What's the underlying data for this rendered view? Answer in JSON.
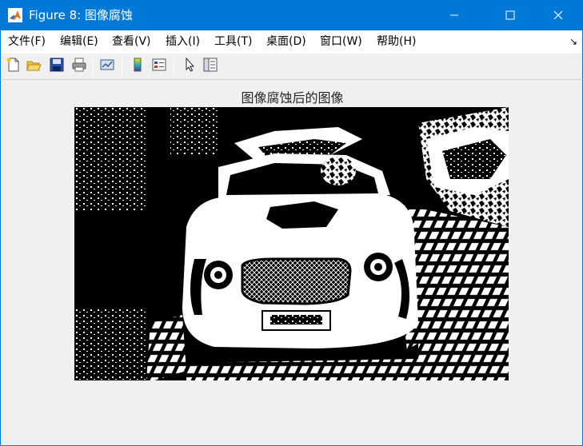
{
  "window": {
    "title": "Figure 8: 图像腐蚀",
    "minimize_icon": "minimize-icon",
    "maximize_icon": "maximize-icon",
    "close_icon": "close-icon"
  },
  "menu": {
    "items": [
      "文件(F)",
      "编辑(E)",
      "查看(V)",
      "插入(I)",
      "工具(T)",
      "桌面(D)",
      "窗口(W)",
      "帮助(H)"
    ],
    "overflow_arrow": "↘"
  },
  "toolbar": {
    "buttons": [
      "new-figure-icon",
      "open-file-icon",
      "save-icon",
      "print-icon",
      "link-plot-icon",
      "colorbar-icon",
      "legend-icon",
      "pointer-icon",
      "property-editor-icon"
    ]
  },
  "figure": {
    "axes_title": "图像腐蚀后的图像",
    "image_description_icon": "eroded-binary-image"
  },
  "colors": {
    "titlebar": "#0078d7",
    "background": "#f0f0f0"
  }
}
